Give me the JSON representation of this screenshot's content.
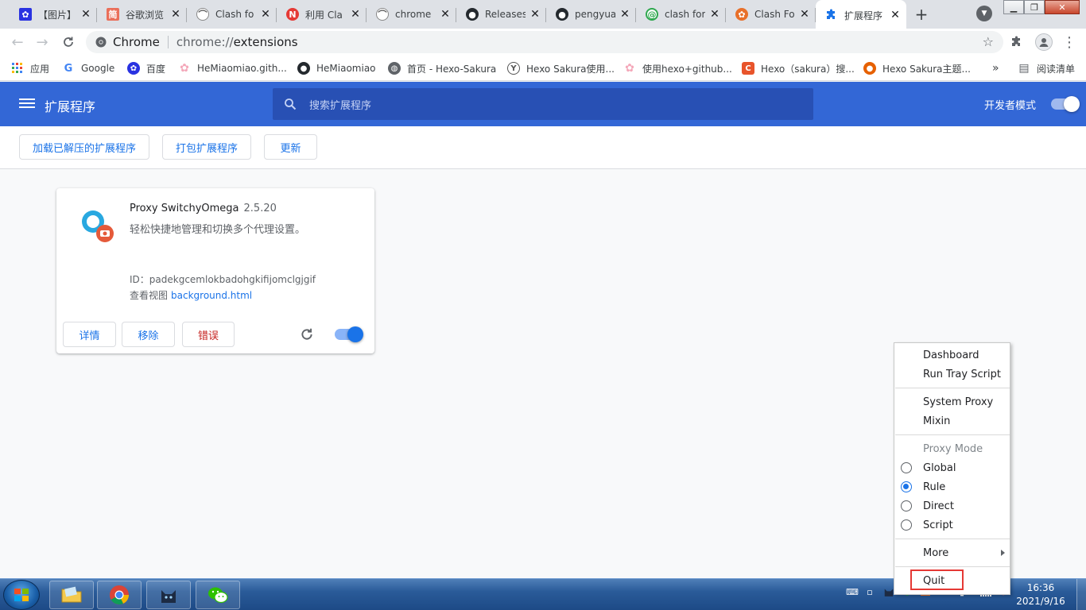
{
  "tabs": [
    {
      "title": "【图片】",
      "icon": "baidu-paw-icon",
      "color": "#2932e1"
    },
    {
      "title": "谷歌浏览",
      "icon": "jianshu-icon",
      "color": "#ea6f5a"
    },
    {
      "title": "Clash fo",
      "icon": "cloudflare-icon",
      "color": "#555555"
    },
    {
      "title": "利用 Cla",
      "icon": "n-logo-icon",
      "color": "#e53935"
    },
    {
      "title": "chrome",
      "icon": "cloudflare-icon",
      "color": "#555555"
    },
    {
      "title": "Releases",
      "icon": "github-icon",
      "color": "#24292e"
    },
    {
      "title": "pengyua",
      "icon": "github-icon",
      "color": "#24292e"
    },
    {
      "title": "clash for",
      "icon": "snail-icon",
      "color": "#2fa84f"
    },
    {
      "title": "Clash Fo",
      "icon": "paw-icon",
      "color": "#e8702a"
    },
    {
      "title": "扩展程序",
      "icon": "puzzle-icon",
      "color": "#1a73e8",
      "active": true
    }
  ],
  "toolbar": {
    "site_label": "Chrome",
    "url_scheme": "chrome://",
    "url_path": "extensions"
  },
  "bookmarks": [
    {
      "label": "应用",
      "icon": "apps-grid-icon",
      "color": "#4285f4"
    },
    {
      "label": "Google",
      "icon": "google-g-icon",
      "color": "#4285f4"
    },
    {
      "label": "百度",
      "icon": "baidu-paw-icon",
      "color": "#2932e1"
    },
    {
      "label": "HeMiaomiao.gith...",
      "icon": "sakura-icon",
      "color": "#f4a7b9"
    },
    {
      "label": "HeMiaomiao",
      "icon": "github-icon",
      "color": "#24292e"
    },
    {
      "label": "首页 - Hexo-Sakura",
      "icon": "globe-icon",
      "color": "#5f6368"
    },
    {
      "label": "Hexo Sakura使用...",
      "icon": "y-logo-icon",
      "color": "#555555"
    },
    {
      "label": "使用hexo+github...",
      "icon": "sakura-icon",
      "color": "#f4a7b9"
    },
    {
      "label": "Hexo（sakura）搜...",
      "icon": "csdn-c-icon",
      "color": "#e8542b"
    },
    {
      "label": "Hexo Sakura主题...",
      "icon": "firefox-icon",
      "color": "#e66000"
    }
  ],
  "bookmarks_more": "»",
  "reading_list": "阅读清单",
  "header": {
    "title": "扩展程序",
    "search_placeholder": "搜索扩展程序",
    "dev_mode_label": "开发者模式",
    "dev_mode_on": true
  },
  "actions": {
    "load_unpacked": "加载已解压的扩展程序",
    "pack": "打包扩展程序",
    "update": "更新"
  },
  "extension": {
    "name": "Proxy SwitchyOmega",
    "version": "2.5.20",
    "description": "轻松快捷地管理和切换多个代理设置。",
    "id_line": "ID：padekgcemlokbadohgkifijomclgjgif",
    "views_label": "查看视图",
    "views_link": "background.html",
    "details_btn": "详情",
    "remove_btn": "移除",
    "errors_btn": "错误",
    "enabled": true
  },
  "context_menu": {
    "dashboard": "Dashboard",
    "run_tray_script": "Run Tray Script",
    "system_proxy": "System Proxy",
    "mixin": "Mixin",
    "proxy_mode_header": "Proxy Mode",
    "modes": [
      {
        "label": "Global",
        "selected": false
      },
      {
        "label": "Rule",
        "selected": true
      },
      {
        "label": "Direct",
        "selected": false
      },
      {
        "label": "Script",
        "selected": false
      }
    ],
    "more": "More",
    "quit": "Quit"
  },
  "taskbar": {
    "time": "16:36",
    "date": "2021/9/16",
    "apps": [
      "explorer-folder-icon",
      "chrome-icon",
      "clash-cat-icon",
      "wechat-icon"
    ]
  }
}
